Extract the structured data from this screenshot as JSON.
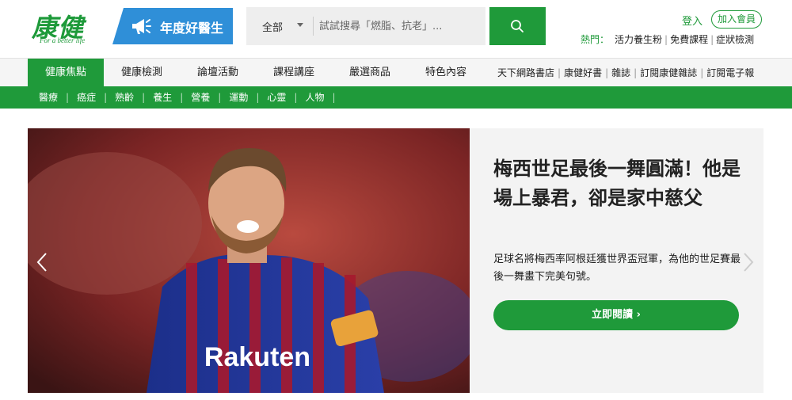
{
  "logo": {
    "main": "康健",
    "sub": "For a better life"
  },
  "doctor_banner": {
    "label": "年度好醫生"
  },
  "search": {
    "category": "全部",
    "placeholder": "試試搜尋「燃脂、抗老」..."
  },
  "account": {
    "login": "登入",
    "join": "加入會員"
  },
  "hot": {
    "label": "熱門：",
    "links": [
      "活力養生粉",
      "免費課程",
      "症狀檢測"
    ]
  },
  "main_nav": {
    "items": [
      "健康焦點",
      "健康檢測",
      "論壇活動",
      "課程講座",
      "嚴選商品",
      "特色內容"
    ],
    "active_index": 0
  },
  "right_nav": {
    "items": [
      "天下網路書店",
      "康健好書",
      "雜誌",
      "訂閱康健雜誌",
      "訂閱電子報"
    ]
  },
  "sub_nav": {
    "items": [
      "醫療",
      "癌症",
      "熟齡",
      "養生",
      "營養",
      "運動",
      "心靈",
      "人物"
    ]
  },
  "hero": {
    "title": "梅西世足最後一舞圓滿！他是場上暴君，卻是家中慈父",
    "description": "足球名將梅西率阿根廷獲世界盃冠軍，為他的世足賽最後一舞畫下完美句號。",
    "button": "立即閱讀",
    "image_text": {
      "sponsor": "Rakuten"
    }
  },
  "colors": {
    "brand_green": "#1f9a3a",
    "banner_blue": "#2f8fd8"
  },
  "icons": [
    "megaphone-icon",
    "search-icon",
    "chevron-left-icon",
    "chevron-right-icon"
  ]
}
